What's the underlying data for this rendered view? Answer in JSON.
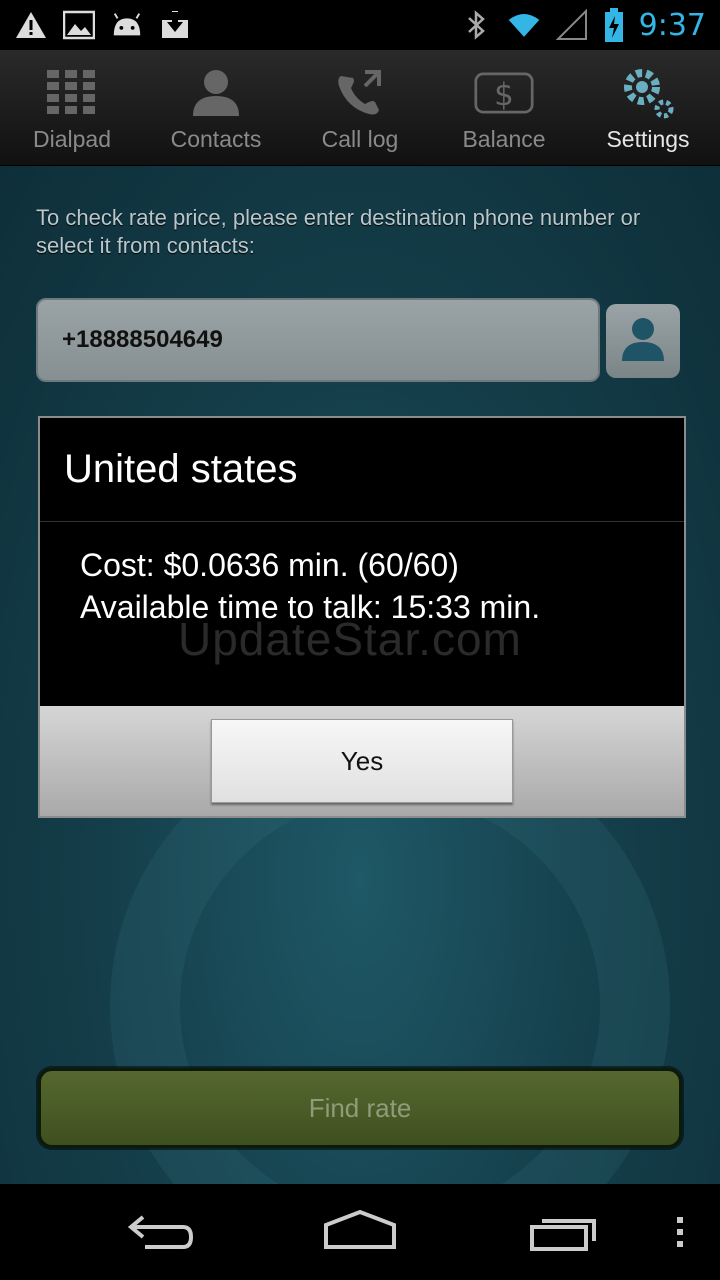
{
  "status_bar": {
    "time": "9:37",
    "left_icons": [
      "warning-icon",
      "image-icon",
      "android-icon",
      "download-icon"
    ],
    "right_icons": [
      "bluetooth-icon",
      "wifi-icon",
      "signal-icon",
      "battery-charging-icon"
    ]
  },
  "tabs": [
    {
      "label": "Dialpad",
      "icon": "dialpad-icon",
      "active": false
    },
    {
      "label": "Contacts",
      "icon": "contacts-icon",
      "active": false
    },
    {
      "label": "Call log",
      "icon": "call-log-icon",
      "active": false
    },
    {
      "label": "Balance",
      "icon": "balance-icon",
      "active": false
    },
    {
      "label": "Settings",
      "icon": "settings-icon",
      "active": true
    }
  ],
  "main": {
    "instructions": "To check rate price, please enter destination phone number or select it from contacts:",
    "phone_value": "+18888504649",
    "find_rate_label": "Find rate"
  },
  "dialog": {
    "title": "United states",
    "cost_line": "Cost: $0.0636 min. (60/60)",
    "time_line": "Available time to talk: 15:33 min.",
    "watermark": "UpdateStar.com",
    "yes_label": "Yes"
  },
  "colors": {
    "accent": "#33b5e5",
    "background": "#143e4a",
    "find_button": "#4a5c28"
  }
}
